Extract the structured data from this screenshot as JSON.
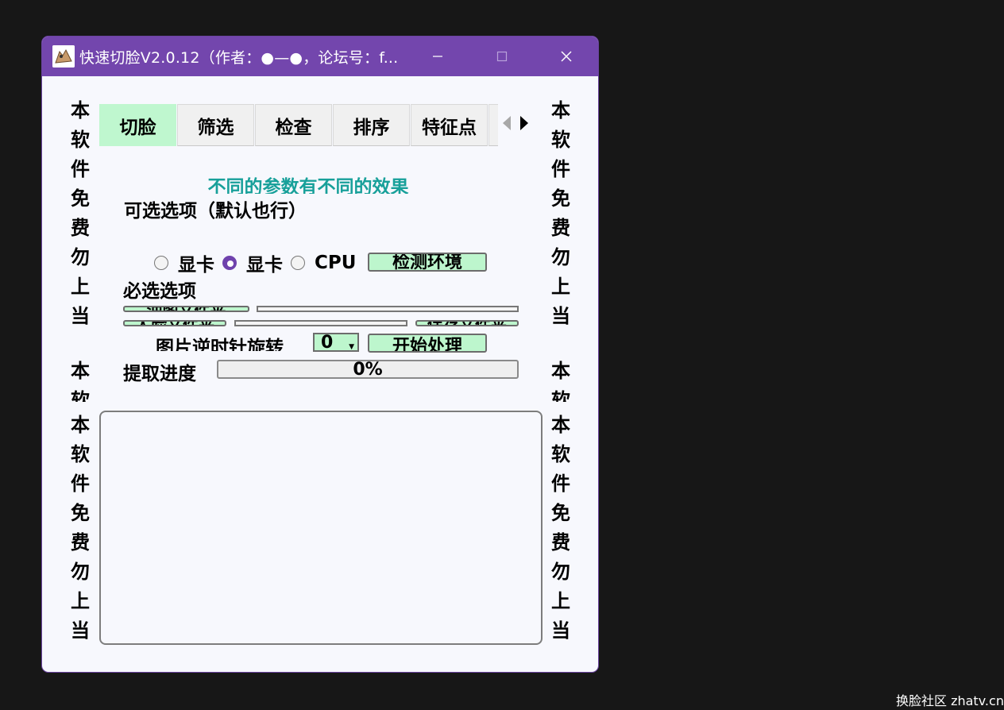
{
  "window": {
    "title": "快速切脸V2.0.12（作者：●—●，论坛号：f...",
    "controls": {
      "minimize": "─",
      "maximize": "☐",
      "close": "✕"
    }
  },
  "side_text": {
    "chars": [
      "本",
      "软",
      "件",
      "免",
      "费",
      "勿",
      "上",
      "当"
    ],
    "partial": [
      "本",
      "软"
    ]
  },
  "tabs": [
    "切脸",
    "筛选",
    "检查",
    "排序",
    "特征点"
  ],
  "tab_arrows": {
    "left": "◀",
    "right": "▶"
  },
  "main": {
    "note": "不同的参数有不同的效果",
    "optional_label": "可选选项（默认也行）",
    "radios": [
      {
        "label": "显卡",
        "checked": false
      },
      {
        "label": "显卡",
        "checked": true
      },
      {
        "label": "CPU",
        "checked": false
      }
    ],
    "detect_button": "检测环境",
    "required_label": "必选选项",
    "src_folder_button": "油图文件夹",
    "face_folder_button": "人脸文件夹",
    "save_folder_button": "保存文件夹",
    "rotate_label": "图片逆时针旋转",
    "rotate_value": "0",
    "start_button": "开始处理",
    "progress_label": "提取进度",
    "progress_text": "0%",
    "progress_value": 0
  },
  "watermark": "换脸社区 zhatv.cn",
  "colors": {
    "titlebar": "#7346ad",
    "accent_green": "#bdf6cd",
    "note_teal": "#18a09a"
  }
}
